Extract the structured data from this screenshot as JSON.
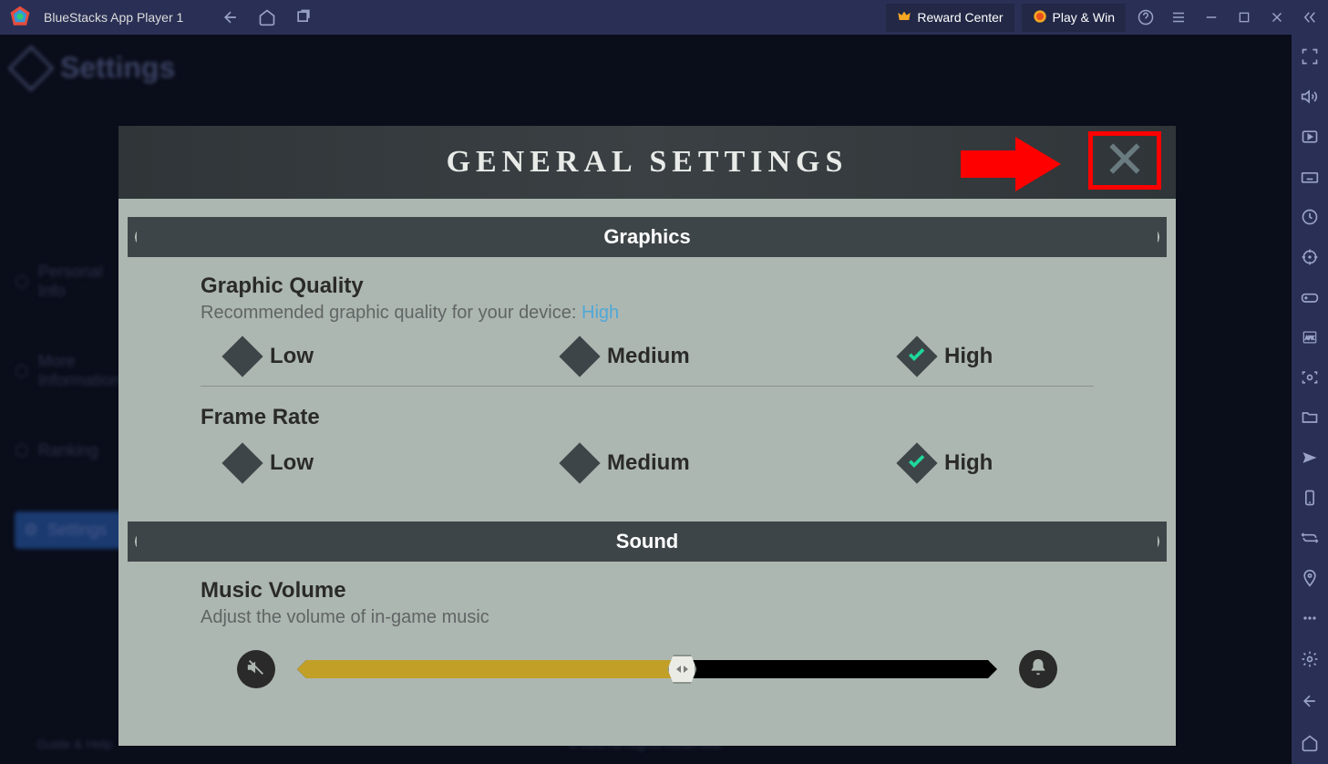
{
  "titlebar": {
    "app_name": "BlueStacks App Player 1",
    "reward_center": "Reward Center",
    "play_win": "Play & Win"
  },
  "background": {
    "settings_label": "Settings",
    "menu_items": [
      "Personal Info",
      "More Information",
      "Ranking",
      "Settings"
    ],
    "guide_help": "Guide & Help",
    "copyright": "© IGG All Rights Reserved."
  },
  "modal": {
    "title": "GENERAL SETTINGS",
    "sections": {
      "graphics": {
        "header": "Graphics",
        "quality": {
          "title": "Graphic Quality",
          "desc_prefix": "Recommended graphic quality for your device: ",
          "desc_highlight": "High",
          "options": [
            "Low",
            "Medium",
            "High"
          ],
          "selected": "High"
        },
        "framerate": {
          "title": "Frame Rate",
          "options": [
            "Low",
            "Medium",
            "High"
          ],
          "selected": "High"
        }
      },
      "sound": {
        "header": "Sound",
        "music": {
          "title": "Music Volume",
          "desc": "Adjust the volume of in-game music",
          "value_percent": 55
        }
      }
    }
  }
}
